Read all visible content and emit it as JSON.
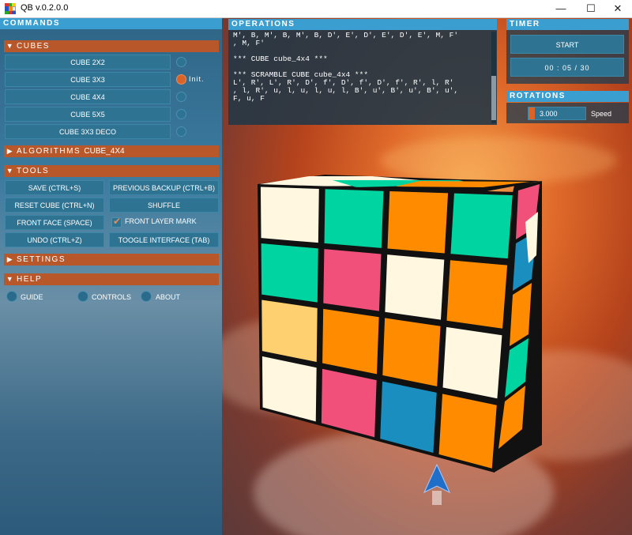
{
  "window": {
    "title": "QB v.0.2.0.0",
    "minimize": "—",
    "maximize": "☐",
    "close": "✕"
  },
  "commands": {
    "header": "COMMANDS"
  },
  "cubes": {
    "section": "CUBES",
    "items": [
      {
        "label": "CUBE 2X2"
      },
      {
        "label": "CUBE 3X3"
      },
      {
        "label": "CUBE 4X4"
      },
      {
        "label": "CUBE 5X5"
      },
      {
        "label": "CUBE 3X3 DECO"
      }
    ],
    "init_label": "Init."
  },
  "algorithms": {
    "section": "ALGORITHMS",
    "current": "CUBE_4X4"
  },
  "tools": {
    "section": "TOOLS",
    "save": "SAVE (CTRL+S)",
    "previous_backup": "PREVIOUS BACKUP (CTRL+B)",
    "reset": "RESET CUBE (CTRL+N)",
    "shuffle": "SHUFFLE",
    "front_face": "FRONT FACE (SPACE)",
    "front_layer_mark": "FRONT LAYER MARK",
    "undo": "UNDO (CTRL+Z)",
    "toggle_interface": "TOOGLE INTERFACE (TAB)"
  },
  "settings": {
    "section": "SETTINGS"
  },
  "help": {
    "section": "HELP",
    "guide": "GUIDE",
    "controls": "CONTROLS",
    "about": "ABOUT"
  },
  "operations": {
    "header": "OPERATIONS",
    "text": "M', B, M', B, M', B, D', E', D', E', D', E', M, F'\n, M, F'\n\n*** CUBE cube_4x4 ***\n\n*** SCRAMBLE CUBE cube_4x4 ***\nL', R', L', R', D', f', D', f', D', f', R', l, R'\n, l, R', u, l, u, l, u, l, B', u', B', u', B', u',\nF, u, F"
  },
  "timer": {
    "header": "TIMER",
    "start": "START",
    "display": "00 : 05 / 30"
  },
  "rotations": {
    "header": "ROTATIONS",
    "speed_value": "3.000",
    "speed_label": "Speed"
  },
  "colors": {
    "accent": "#3a9fd0",
    "section": "#b8582a",
    "button": "#2f7393",
    "orange": "#ff8c00",
    "teal": "#00d4a0",
    "pink": "#f0507a",
    "cream": "#fff7e0",
    "yellow": "#ffd070",
    "blue": "#1a8fbf"
  },
  "cube": {
    "front": [
      [
        "cream",
        "teal",
        "orange",
        "teal"
      ],
      [
        "teal",
        "pink",
        "cream",
        "orange"
      ],
      [
        "yellow",
        "orange",
        "orange",
        "cream"
      ],
      [
        "cream",
        "pink",
        "blue",
        "orange"
      ]
    ]
  }
}
